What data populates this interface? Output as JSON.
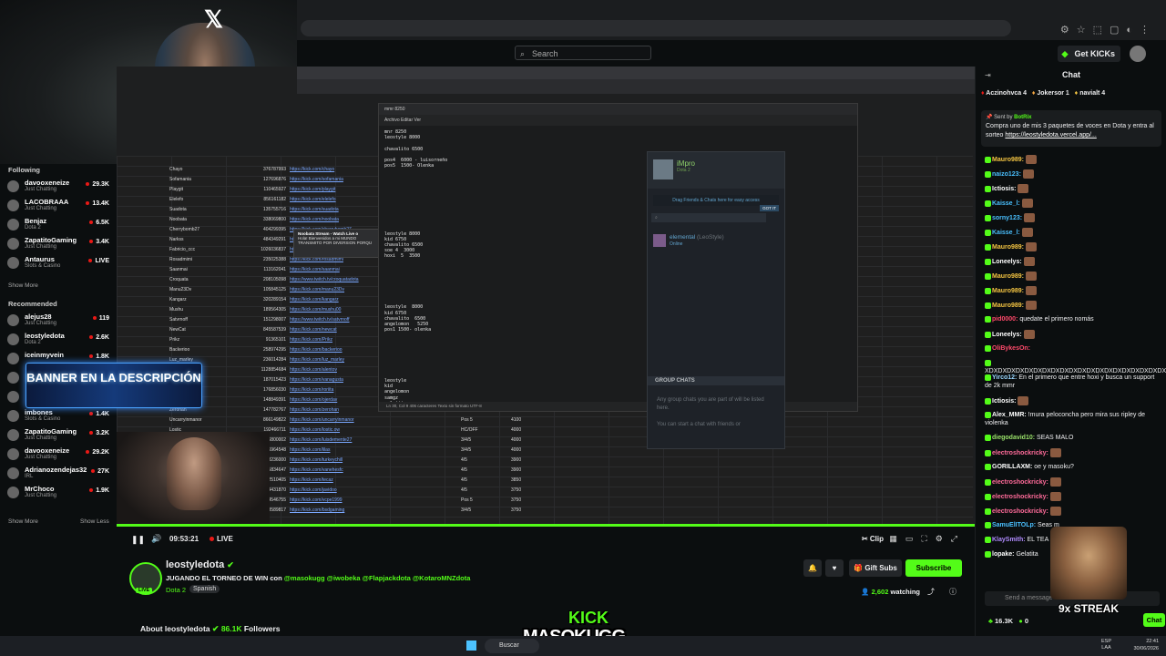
{
  "browser": {
    "search_placeholder": "Search",
    "get_kicks": "Get KICKs"
  },
  "sidebar": {
    "following_title": "Following",
    "following": [
      {
        "name": "davooxeneize",
        "category": "Just Chatting",
        "viewers": "29.3K"
      },
      {
        "name": "LACOBRAAA",
        "category": "Just Chatting",
        "viewers": "13.4K"
      },
      {
        "name": "Benjaz",
        "category": "Dota 2",
        "viewers": "6.5K"
      },
      {
        "name": "ZapatitoGaming",
        "category": "Just Chatting",
        "viewers": "3.4K"
      },
      {
        "name": "Antaurus",
        "category": "Slots & Casino",
        "viewers": "LIVE"
      }
    ],
    "show_more_1": "Show More",
    "recommended_title": "Recommended",
    "recommended": [
      {
        "name": "alejus28",
        "category": "Just Chatting",
        "viewers": "119"
      },
      {
        "name": "leostyledota",
        "category": "Dota 2",
        "viewers": "2.6K"
      },
      {
        "name": "iceinmyvein",
        "category": "",
        "viewers": "1.8K"
      },
      {
        "name": "",
        "category": "",
        "viewers": ""
      },
      {
        "name": "",
        "category": "",
        "viewers": ""
      },
      {
        "name": "imbones",
        "category": "Slots & Casino",
        "viewers": "1.4K"
      },
      {
        "name": "ZapatitoGaming",
        "category": "Just Chatting",
        "viewers": "3.2K"
      },
      {
        "name": "davooxeneize",
        "category": "Just Chatting",
        "viewers": "29.2K"
      },
      {
        "name": "Adrianozendejas32",
        "category": "IRL",
        "viewers": "27K"
      },
      {
        "name": "MrChoco",
        "category": "Just Chatting",
        "viewers": "1.9K"
      }
    ],
    "show_more_2": "Show More",
    "show_less": "Show Less"
  },
  "banner_text": "BANNER EN LA DESCRIPCIÓN",
  "sheet": {
    "rows": [
      {
        "n": "Chayo",
        "v": "376787993",
        "l": "https://kick.com/chayo"
      },
      {
        "n": "Sofamania",
        "v": "127696876",
        "l": "https://kick.com/sofamania"
      },
      {
        "n": "Playgit",
        "v": "110465927",
        "l": "https://kick.com/playgit"
      },
      {
        "n": "Elelefo",
        "v": "856161182",
        "l": "https://kick.com/elelefo"
      },
      {
        "n": "Suadota",
        "v": "135755716",
        "l": "https://kick.com/suadota"
      },
      {
        "n": "Noobata",
        "v": "338069800",
        "l": "https://kick.com/noobata"
      },
      {
        "n": "Cherrybomb27",
        "v": "404299395",
        "l": "https://kick.com/cherrybomb27"
      },
      {
        "n": "Narkss",
        "v": "484349291",
        "l": "https://kick.com/narkss"
      },
      {
        "n": "Fabricio_ccc",
        "v": "1026036837",
        "l": "https://kick.com/fabricio"
      },
      {
        "n": "Rosadmimi",
        "v": "235025388",
        "l": "https://kick.com/rosadmimi"
      },
      {
        "n": "Saanmai",
        "v": "113162041",
        "l": "https://kick.com/saanmai"
      },
      {
        "n": "Croquata",
        "v": "208105098",
        "l": "https://www.twitch.tv/croquatadota"
      },
      {
        "n": "Manu23Dv",
        "v": "105845125",
        "l": "https://kick.com/manu23Dv"
      },
      {
        "n": "Kangarz",
        "v": "320289154",
        "l": "https://kick.com/kangarz"
      },
      {
        "n": "Mushu",
        "v": "189564305",
        "l": "https://kick.com/mushu00"
      },
      {
        "n": "Satvrnoff",
        "v": "151298007",
        "l": "https://www.twitch.tv/satvrnoff"
      },
      {
        "n": "NewCat",
        "v": "845587539",
        "l": "https://kick.com/newcat"
      },
      {
        "n": "Prikz",
        "v": "91365101",
        "l": "https://kick.com/Prikz"
      },
      {
        "n": "Backerioo",
        "v": "258974295",
        "l": "https://kick.com/backerioo"
      },
      {
        "n": "Luz_marley",
        "v": "236014284",
        "l": "https://kick.com/luz_marley"
      },
      {
        "n": "Alentov",
        "v": "1128854684",
        "l": "https://kick.com/alentov"
      },
      {
        "n": "Vanagusta",
        "v": "187015423",
        "l": "https://kick.com/vanagusta"
      },
      {
        "n": "Roriita",
        "v": "176856030",
        "l": "https://kick.com/roriita"
      },
      {
        "n": "Ojerdav",
        "v": "148849391",
        "l": "https://kick.com/ojerdav",
        "p": "4/5",
        "s": "4100"
      },
      {
        "n": "Zerohan",
        "v": "147782767",
        "l": "https://kick.com/zerohan",
        "p": "HC/4",
        "s": "4100"
      },
      {
        "n": "Uncarryinmanor",
        "v": "866149822",
        "l": "https://kick.com/uncarryinmanor",
        "p": "Pos 5",
        "s": "4100"
      },
      {
        "n": "Lostic",
        "v": "192466711",
        "l": "https://kick.com/lostic.ow",
        "p": "HC/OFF",
        "s": "4000"
      },
      {
        "n": "Luisdemente27",
        "v": "126800002",
        "l": "https://kick.com/luisdemente27",
        "p": "3/4/5",
        "s": "4000"
      },
      {
        "n": "Lilas",
        "v": "226964548",
        "l": "https://kick.com/lilas",
        "p": "3/4/5",
        "s": "4000"
      },
      {
        "n": "Turkeychill",
        "v": "1098236000",
        "l": "https://kick.com/turkeychill",
        "p": "4/5",
        "s": "3900"
      },
      {
        "n": "Vanehesfc",
        "v": "1185834647",
        "l": "https://kick.com/vanehesfc",
        "p": "4/5",
        "s": "3900"
      },
      {
        "n": "Tecaz",
        "v": "192510405",
        "l": "https://kick.com/tecaz",
        "p": "4/5",
        "s": "3850"
      },
      {
        "n": "Javidoo",
        "v": "1034431870",
        "l": "https://kick.com/javidoo",
        "p": "4/5",
        "s": "3750"
      },
      {
        "n": "Vcpe1999",
        "v": "124546755",
        "l": "https://kick.com/vcpe1999",
        "p": "Pos 5",
        "s": "3750"
      },
      {
        "n": "Bsdgaming",
        "v": "248589817",
        "l": "https://kick.com/bsdgaming",
        "p": "3/4/5",
        "s": "3750"
      }
    ]
  },
  "notepad": {
    "title": "mmr 8250",
    "menu": "Archivo    Editar    Ver",
    "text": "mnr 8250\nleostyle 8000\n\nchavalito 6500\n\npos4  6000 - luisorneño\npos5  1500- Olenka\n\n\n\n\n\n\n\n\n\n\n\nleostyle 8000\nkid 6750\nchavalito 6500\nsoe 4  3000\nhoxi  5  3500\n\n\n\n\n\n\n\n\nleostyle  8000\nkid 6750\nchavalito  6500\nangelomon   5250\npos1 1500- olenka\n\n\n\n\n\n\n\n\nleostyle\nkid\nangelomon\nsamgz\ngelatita",
    "status": "Ln 30, Col 9    406 caracteres                           Texto sin formato                                                                                  UTF-8"
  },
  "steam": {
    "user": "iMpro",
    "status": "Dota 2",
    "drag": "Drag Friends & Chats here for easy access",
    "gotit": "GOT IT",
    "friend_name": "elemental",
    "friend_alias": "(LeoStyle)",
    "friend_status": "Online",
    "group_chats": "GROUP CHATS",
    "group_text": "Any group chats you are part of will be listed here.\n\nYou can start a chat with friends or"
  },
  "popup": {
    "title": "Noobata Stream - Watch Live o",
    "line": "Hola! Bienvenidos a mi MUNDO  TRANSMITO POR DIVERSION PORQU"
  },
  "player": {
    "time": "09:53:21",
    "live": "LIVE",
    "clip": "Clip"
  },
  "channel": {
    "username": "leostyledota",
    "title_prefix": "JUGANDO EL TORNEO DE WIN con ",
    "mentions": "@masokugg @iwobeka @Flapjackdota @KotaroMNZdota",
    "category": "Dota 2",
    "language": "Spanish",
    "live_badge": "LIVE",
    "gift_subs": "Gift Subs",
    "subscribe": "Subscribe",
    "watching_count": "2,602",
    "watching_label": " watching",
    "about_prefix": "About leostyledota",
    "followers_count": "86.1K",
    "followers_label": " Followers"
  },
  "chat": {
    "title": "Chat",
    "gifter_1": "Aczinohvca 4",
    "gifter_2": "Jokersor 1",
    "gifter_3": "navialt 4",
    "pinned_by": "Sent by",
    "pinned_bot": "BotRix",
    "pinned_text": "Compra uno de mis 3 paquetes de voces en Dota y entra al sorteo ",
    "pinned_link": "https://leostyledota.vercel.app/...",
    "messages": [
      {
        "u": "Mauro989:",
        "c": "#f5c542",
        "t": "",
        "e": true
      },
      {
        "u": "naizo123:",
        "c": "#4ac0ff",
        "t": "",
        "e": true
      },
      {
        "u": "Ictiosis:",
        "c": "#ffffff",
        "t": "",
        "e": true
      },
      {
        "u": "Kaisse_l:",
        "c": "#4ac0ff",
        "t": "",
        "e": true
      },
      {
        "u": "sorny123:",
        "c": "#4ac0ff",
        "t": "",
        "e": true
      },
      {
        "u": "Kaisse_l:",
        "c": "#4ac0ff",
        "t": "",
        "e": true
      },
      {
        "u": "Mauro989:",
        "c": "#f5c542",
        "t": "",
        "e": true
      },
      {
        "u": "Loneelys:",
        "c": "#ffffff",
        "t": "",
        "e": true
      },
      {
        "u": "Mauro989:",
        "c": "#f5c542",
        "t": "",
        "e": true
      },
      {
        "u": "Mauro989:",
        "c": "#f5c542",
        "t": "",
        "e": true
      },
      {
        "u": "Mauro989:",
        "c": "#f5c542",
        "t": "",
        "e": true
      },
      {
        "u": "pid0000:",
        "c": "#ff4a6b",
        "t": " quedate el primero nomás",
        "e": false
      },
      {
        "u": "Loneelys:",
        "c": "#ffffff",
        "t": "",
        "e": true
      },
      {
        "u": "OliBykesOn:",
        "c": "#ff4a6b",
        "t": "",
        "e": false
      },
      {
        "u": "",
        "c": "#ffffff",
        "t": "XDXDXDXDXDXDXDXDXDXDXDXDXDXDXDXDXDXDXDXDXD",
        "e": false
      },
      {
        "u": "Yirco12:",
        "c": "#9ad7ff",
        "t": " En el primero que entre hoxi y busca un support de 2k mmr",
        "e": false
      },
      {
        "u": "Ictiosis:",
        "c": "#ffffff",
        "t": "",
        "e": true
      },
      {
        "u": "Alex_MMR:",
        "c": "#ffffff",
        "t": " !mura peloconcha pero mira sus ripley de violenka",
        "e": false
      },
      {
        "u": "diegodavid10:",
        "c": "#9be36b",
        "t": " SEAS MALO",
        "e": false
      },
      {
        "u": "electroshockricky:",
        "c": "#ff6b9a",
        "t": "",
        "e": true
      },
      {
        "u": "GORILLAXM:",
        "c": "#ffffff",
        "t": " oe y masoku?",
        "e": false
      },
      {
        "u": "electroshockricky:",
        "c": "#ff6b9a",
        "t": "",
        "e": true
      },
      {
        "u": "electroshockricky:",
        "c": "#ff6b9a",
        "t": "",
        "e": true
      },
      {
        "u": "electroshockricky:",
        "c": "#ff6b9a",
        "t": "",
        "e": true
      },
      {
        "u": "SamuElITOLp:",
        "c": "#4ac0ff",
        "t": " Seas m",
        "e": false
      },
      {
        "u": "KlaySmith:",
        "c": "#b18cff",
        "t": " EL TEA",
        "e": false
      },
      {
        "u": "lopake:",
        "c": "#ffffff",
        "t": " Gelatita",
        "e": false
      }
    ],
    "input_placeholder": "Send a message",
    "kicks_count": "16.3K",
    "zero": "0",
    "send_label": "Chat",
    "streak": "9x STREAK"
  },
  "overlay_logo": {
    "kick": "KICK",
    "name": "MASOKUGG"
  },
  "taskbar": {
    "search": "Buscar",
    "lang": "ESP\nLAA",
    "time": "22:41",
    "date": "30/06/2026"
  }
}
